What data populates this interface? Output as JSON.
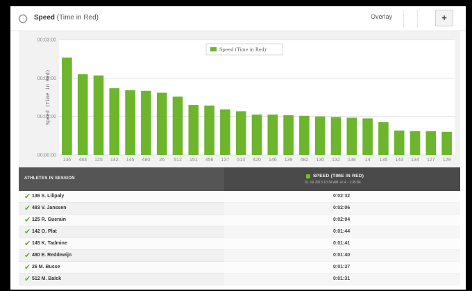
{
  "header": {
    "title_main": "Speed",
    "title_sub": "(Time in Red)",
    "overlay_label": "Overlay",
    "add_label": "+"
  },
  "table": {
    "col_athletes": "ATHLETES IN SESSION",
    "col_speed": "SPEED (TIME IN RED)",
    "col_speed_sub": "31 Jul 2013 10:34 AM +0.4 - 1:35.84",
    "rows": [
      {
        "name": "136 S. Lilipaly",
        "value": "0:02:32"
      },
      {
        "name": "483 V. Janssen",
        "value": "0:02:06"
      },
      {
        "name": "125 R. Guerain",
        "value": "0:02:04"
      },
      {
        "name": "142 O. Plat",
        "value": "0:01:44"
      },
      {
        "name": "145 K. Tadmine",
        "value": "0:01:41"
      },
      {
        "name": "480 E. Reddewijn",
        "value": "0:01:40"
      },
      {
        "name": "26 M. Busse",
        "value": "0:01:37"
      },
      {
        "name": "512 M. Balck",
        "value": "0:01:31"
      }
    ]
  },
  "chart_data": {
    "type": "bar",
    "title": "",
    "ylabel": "Speed (Time in Red)",
    "xlabel": "",
    "legend": [
      "Speed (Time in Red)"
    ],
    "legend_position": "top-center",
    "bar_color": "#6cb52d",
    "y_ticks": [
      "00:00:00",
      "00:01:00",
      "00:02:00",
      "00:03:00"
    ],
    "ylim_seconds": [
      0,
      180
    ],
    "grid": true,
    "categories": [
      "136",
      "483",
      "125",
      "142",
      "145",
      "480",
      "26",
      "512",
      "151",
      "456",
      "137",
      "513",
      "420",
      "146",
      "139",
      "482",
      "130",
      "132",
      "138",
      "14",
      "135",
      "143",
      "134",
      "127",
      "129"
    ],
    "values_seconds": [
      152,
      126,
      124,
      104,
      101,
      100,
      97,
      91,
      78,
      77,
      71,
      68,
      63,
      63,
      62,
      61,
      60,
      59,
      58,
      57,
      51,
      38,
      37,
      37,
      36
    ]
  }
}
